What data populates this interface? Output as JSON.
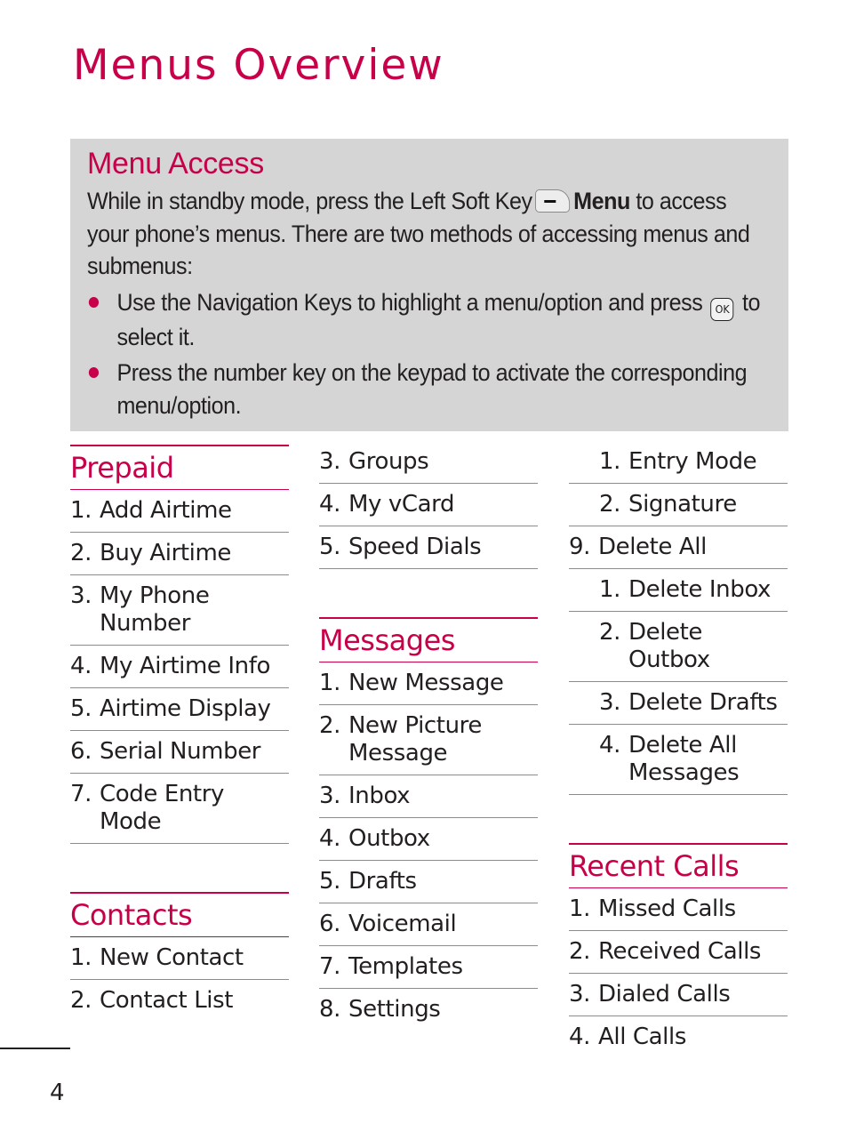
{
  "page": {
    "title": "Menus Overview",
    "page_number": "4",
    "accent_color": "#c8004a",
    "box_background": "#d5d5d5"
  },
  "menu_access": {
    "title": "Menu Access",
    "intro_before_key": "While in standby mode, press the Left Soft Key",
    "soft_key_icon": "left-soft-key-icon",
    "menu_label": "Menu",
    "intro_after_key": " to access your phone’s menus. There are two methods of accessing menus and submenus:",
    "bullets": [
      {
        "before": "Use the Navigation Keys to highlight a menu/option and press",
        "key_label": "OK",
        "after": "to select it."
      },
      {
        "text": "Press the number key on the keypad to activate the corresponding menu/option."
      }
    ]
  },
  "sections": {
    "prepaid": {
      "title": "Prepaid",
      "items": [
        {
          "num": "1.",
          "label": "Add Airtime"
        },
        {
          "num": "2.",
          "label": "Buy Airtime"
        },
        {
          "num": "3.",
          "label": "My Phone Number"
        },
        {
          "num": "4.",
          "label": "My Airtime Info"
        },
        {
          "num": "5.",
          "label": "Airtime Display"
        },
        {
          "num": "6.",
          "label": "Serial Number"
        },
        {
          "num": "7.",
          "label": "Code Entry Mode"
        }
      ]
    },
    "contacts": {
      "title": "Contacts",
      "items": [
        {
          "num": "1.",
          "label": "New Contact"
        },
        {
          "num": "2.",
          "label": "Contact List"
        },
        {
          "num": "3.",
          "label": "Groups"
        },
        {
          "num": "4.",
          "label": "My vCard"
        },
        {
          "num": "5.",
          "label": "Speed Dials"
        }
      ]
    },
    "messages": {
      "title": "Messages",
      "items": [
        {
          "num": "1.",
          "label": "New Message"
        },
        {
          "num": "2.",
          "label": "New Picture Message"
        },
        {
          "num": "3.",
          "label": "Inbox"
        },
        {
          "num": "4.",
          "label": "Outbox"
        },
        {
          "num": "5.",
          "label": "Drafts"
        },
        {
          "num": "6.",
          "label": "Voicemail"
        },
        {
          "num": "7.",
          "label": "Templates"
        },
        {
          "num": "8.",
          "label": "Settings"
        },
        {
          "num": "1.",
          "label": "Entry Mode"
        },
        {
          "num": "2.",
          "label": "Signature"
        },
        {
          "num": "9.",
          "label": "Delete All"
        },
        {
          "num": "1.",
          "label": "Delete Inbox"
        },
        {
          "num": "2.",
          "label": "Delete Outbox"
        },
        {
          "num": "3.",
          "label": "Delete Drafts"
        },
        {
          "num": "4.",
          "label": "Delete All Messages"
        }
      ]
    },
    "recent_calls": {
      "title": "Recent Calls",
      "items": [
        {
          "num": "1.",
          "label": "Missed Calls"
        },
        {
          "num": "2.",
          "label": "Received Calls"
        },
        {
          "num": "3.",
          "label": "Dialed Calls"
        },
        {
          "num": "4.",
          "label": "All Calls"
        }
      ]
    }
  }
}
